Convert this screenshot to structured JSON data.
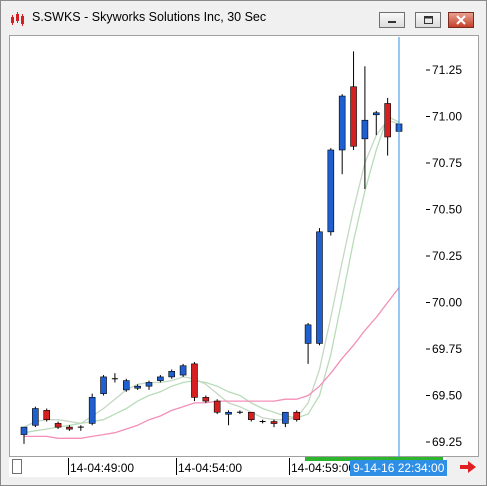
{
  "window": {
    "title": "S.SWKS - Skyworks Solutions Inc, 30 Sec"
  },
  "colors": {
    "up": "#1f5fd0",
    "down": "#d42020",
    "ma_fast": "#c4d8c4",
    "ma_mid": "#b8dcb8",
    "ma_slow": "#f48fb8",
    "cursor": "#2f8fe6",
    "nav_arrow": "#e02020"
  },
  "icons": {
    "app": "chart-app-icon",
    "minimize": "minimize-icon",
    "maximize": "maximize-icon",
    "close": "close-icon",
    "next": "red-arrow-right-icon"
  },
  "axis": {
    "y_ticks": [
      "71.25",
      "71.00",
      "70.75",
      "70.50",
      "70.25",
      "70.00",
      "69.75",
      "69.50",
      "69.25"
    ],
    "x_labels": [
      "14-04:49:00",
      "14-04:54:00",
      "14-04:59:00"
    ],
    "cursor_label": "9-14-16 22:34:00"
  },
  "chart_data": {
    "type": "candlestick",
    "title": "S.SWKS - Skyworks Solutions Inc, 30 Sec",
    "ylim": [
      69.18,
      71.43
    ],
    "y_ticks": [
      71.25,
      71.0,
      70.75,
      70.5,
      70.25,
      70.0,
      69.75,
      69.5,
      69.25
    ],
    "x_tick_labels": [
      "14-04:49:00",
      "14-04:54:00",
      "14-04:59:00"
    ],
    "cursor_label": "9-14-16 22:34:00",
    "candles": [
      {
        "open": 69.29,
        "high": 69.31,
        "low": 69.24,
        "close": 69.33,
        "dir": "up"
      },
      {
        "open": 69.34,
        "high": 69.44,
        "low": 69.33,
        "close": 69.43,
        "dir": "up"
      },
      {
        "open": 69.42,
        "high": 69.43,
        "low": 69.36,
        "close": 69.37,
        "dir": "down"
      },
      {
        "open": 69.35,
        "high": 69.36,
        "low": 69.32,
        "close": 69.33,
        "dir": "down"
      },
      {
        "open": 69.33,
        "high": 69.34,
        "low": 69.31,
        "close": 69.32,
        "dir": "down"
      },
      {
        "open": 69.33,
        "high": 69.34,
        "low": 69.31,
        "close": 69.33,
        "dir": "flat"
      },
      {
        "open": 69.35,
        "high": 69.51,
        "low": 69.34,
        "close": 69.49,
        "dir": "up"
      },
      {
        "open": 69.51,
        "high": 69.61,
        "low": 69.5,
        "close": 69.6,
        "dir": "up"
      },
      {
        "open": 69.58,
        "high": 69.62,
        "low": 69.57,
        "close": 69.59,
        "dir": "flat"
      },
      {
        "open": 69.53,
        "high": 69.59,
        "low": 69.52,
        "close": 69.58,
        "dir": "up"
      },
      {
        "open": 69.54,
        "high": 69.56,
        "low": 69.53,
        "close": 69.55,
        "dir": "up"
      },
      {
        "open": 69.55,
        "high": 69.58,
        "low": 69.53,
        "close": 69.57,
        "dir": "up"
      },
      {
        "open": 69.58,
        "high": 69.61,
        "low": 69.57,
        "close": 69.6,
        "dir": "up"
      },
      {
        "open": 69.6,
        "high": 69.64,
        "low": 69.59,
        "close": 69.63,
        "dir": "up"
      },
      {
        "open": 69.61,
        "high": 69.67,
        "low": 69.6,
        "close": 69.66,
        "dir": "up"
      },
      {
        "open": 69.67,
        "high": 69.68,
        "low": 69.47,
        "close": 69.49,
        "dir": "down"
      },
      {
        "open": 69.49,
        "high": 69.5,
        "low": 69.46,
        "close": 69.47,
        "dir": "down"
      },
      {
        "open": 69.47,
        "high": 69.48,
        "low": 69.4,
        "close": 69.41,
        "dir": "down"
      },
      {
        "open": 69.4,
        "high": 69.42,
        "low": 69.34,
        "close": 69.41,
        "dir": "up"
      },
      {
        "open": 69.41,
        "high": 69.42,
        "low": 69.4,
        "close": 69.41,
        "dir": "flat"
      },
      {
        "open": 69.41,
        "high": 69.41,
        "low": 69.36,
        "close": 69.37,
        "dir": "down"
      },
      {
        "open": 69.36,
        "high": 69.37,
        "low": 69.35,
        "close": 69.36,
        "dir": "flat"
      },
      {
        "open": 69.36,
        "high": 69.37,
        "low": 69.33,
        "close": 69.35,
        "dir": "down"
      },
      {
        "open": 69.35,
        "high": 69.4,
        "low": 69.33,
        "close": 69.41,
        "dir": "up"
      },
      {
        "open": 69.37,
        "high": 69.42,
        "low": 69.36,
        "close": 69.41,
        "dir": "down"
      },
      {
        "open": 69.78,
        "high": 69.89,
        "low": 69.67,
        "close": 69.88,
        "dir": "up"
      },
      {
        "open": 69.78,
        "high": 70.4,
        "low": 69.77,
        "close": 70.38,
        "dir": "up"
      },
      {
        "open": 70.38,
        "high": 70.83,
        "low": 70.36,
        "close": 70.82,
        "dir": "up"
      },
      {
        "open": 70.82,
        "high": 71.12,
        "low": 70.69,
        "close": 71.11,
        "dir": "up"
      },
      {
        "open": 71.16,
        "high": 71.35,
        "low": 70.82,
        "close": 70.84,
        "dir": "down"
      },
      {
        "open": 70.88,
        "high": 71.27,
        "low": 70.61,
        "close": 70.98,
        "dir": "up"
      },
      {
        "open": 71.01,
        "high": 71.03,
        "low": 70.9,
        "close": 71.02,
        "dir": "up"
      },
      {
        "open": 71.07,
        "high": 71.1,
        "low": 70.79,
        "close": 70.89,
        "dir": "down"
      },
      {
        "open": 70.92,
        "high": 70.98,
        "low": 70.8,
        "close": 70.96,
        "dir": "up"
      }
    ],
    "series": [
      {
        "values": [
          69.33,
          69.36,
          69.37,
          69.37,
          69.36,
          69.35,
          69.39,
          69.43,
          69.48,
          69.53,
          69.56,
          69.57,
          69.57,
          69.58,
          69.6,
          69.59,
          69.56,
          69.51,
          69.46,
          69.44,
          69.41,
          69.38,
          69.37,
          69.37,
          69.38,
          69.46,
          69.64,
          69.92,
          70.22,
          70.5,
          70.75,
          70.9,
          70.98,
          70.96
        ]
      },
      {
        "values": [
          69.3,
          69.31,
          69.32,
          69.33,
          69.34,
          69.35,
          69.36,
          69.37,
          69.4,
          69.43,
          69.47,
          69.5,
          69.52,
          69.55,
          69.57,
          69.58,
          69.57,
          69.55,
          69.52,
          69.5,
          69.46,
          69.43,
          69.41,
          69.39,
          69.38,
          69.4,
          69.5,
          69.72,
          70.02,
          70.33,
          70.6,
          70.82,
          71.0,
          70.97
        ]
      },
      {
        "values": [
          69.28,
          69.28,
          69.28,
          69.27,
          69.27,
          69.27,
          69.28,
          69.29,
          69.3,
          69.32,
          69.34,
          69.37,
          69.39,
          69.42,
          69.44,
          69.46,
          69.46,
          69.47,
          69.47,
          69.47,
          69.47,
          69.47,
          69.47,
          69.48,
          69.48,
          69.5,
          69.55,
          69.62,
          69.7,
          69.77,
          69.85,
          69.92,
          70.0,
          70.08
        ]
      }
    ]
  }
}
